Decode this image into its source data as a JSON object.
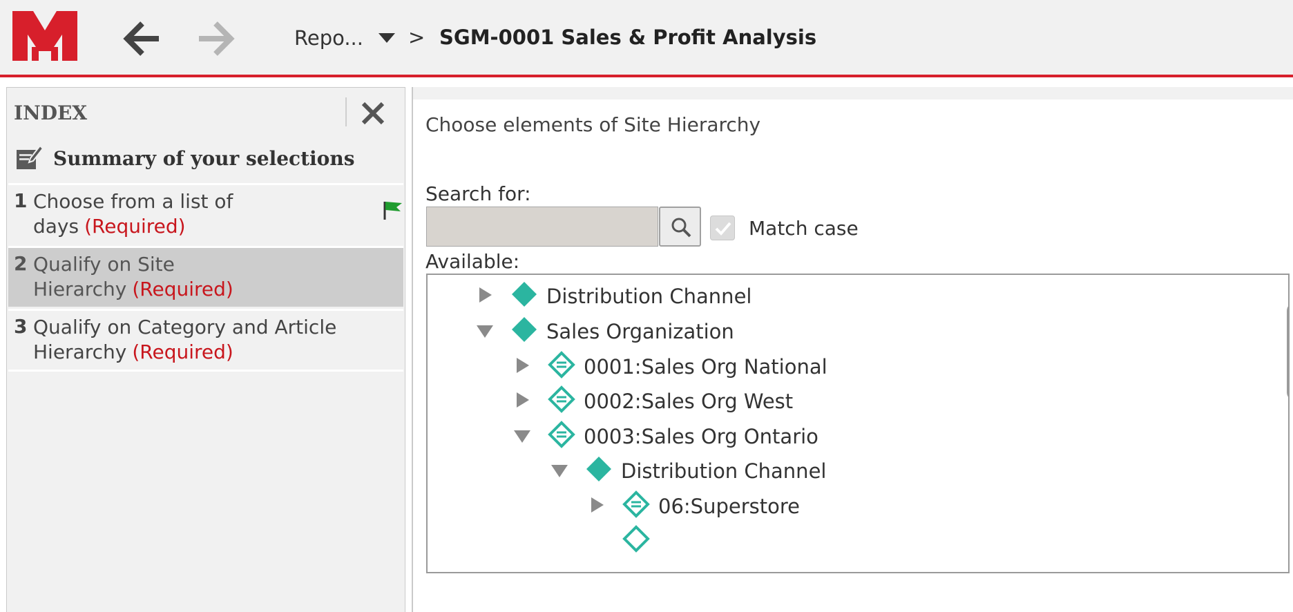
{
  "header": {
    "breadcrumb_root": "Repo...",
    "breadcrumb_separator": ">",
    "report_title": "SGM-0001 Sales & Profit Analysis",
    "accent_color": "#d71f2b"
  },
  "index": {
    "title": "INDEX",
    "summary_label": "Summary of your selections",
    "steps": [
      {
        "number": "1",
        "label_line1": "Choose from a list of",
        "label_line2": "days",
        "required": "(Required)",
        "state": "completed"
      },
      {
        "number": "2",
        "label_line1": "Qualify on Site",
        "label_line2": "Hierarchy",
        "required": "(Required)",
        "state": "active"
      },
      {
        "number": "3",
        "label_line1": "Qualify on Category and Article",
        "label_line2": "Hierarchy",
        "required": "(Required)",
        "state": "pending"
      }
    ]
  },
  "main": {
    "heading": "Choose elements of Site Hierarchy",
    "search_label": "Search for:",
    "search_value": "",
    "match_case_label": "Match case",
    "match_case_checked": true,
    "available_label": "Available:",
    "tree": [
      {
        "label": "Distribution Channel",
        "level": 0,
        "expanded": false,
        "icon": "solid-diamond-icon"
      },
      {
        "label": "Sales Organization",
        "level": 0,
        "expanded": true,
        "icon": "solid-diamond-icon"
      },
      {
        "label": "0001:Sales Org National",
        "level": 1,
        "expanded": false,
        "icon": "element-diamond-icon"
      },
      {
        "label": "0002:Sales Org West",
        "level": 1,
        "expanded": false,
        "icon": "element-diamond-icon"
      },
      {
        "label": "0003:Sales Org Ontario",
        "level": 1,
        "expanded": true,
        "icon": "element-diamond-icon"
      },
      {
        "label": "Distribution Channel",
        "level": 2,
        "expanded": true,
        "icon": "solid-diamond-icon"
      },
      {
        "label": "06:Superstore",
        "level": 3,
        "expanded": false,
        "icon": "element-diamond-icon"
      }
    ]
  }
}
